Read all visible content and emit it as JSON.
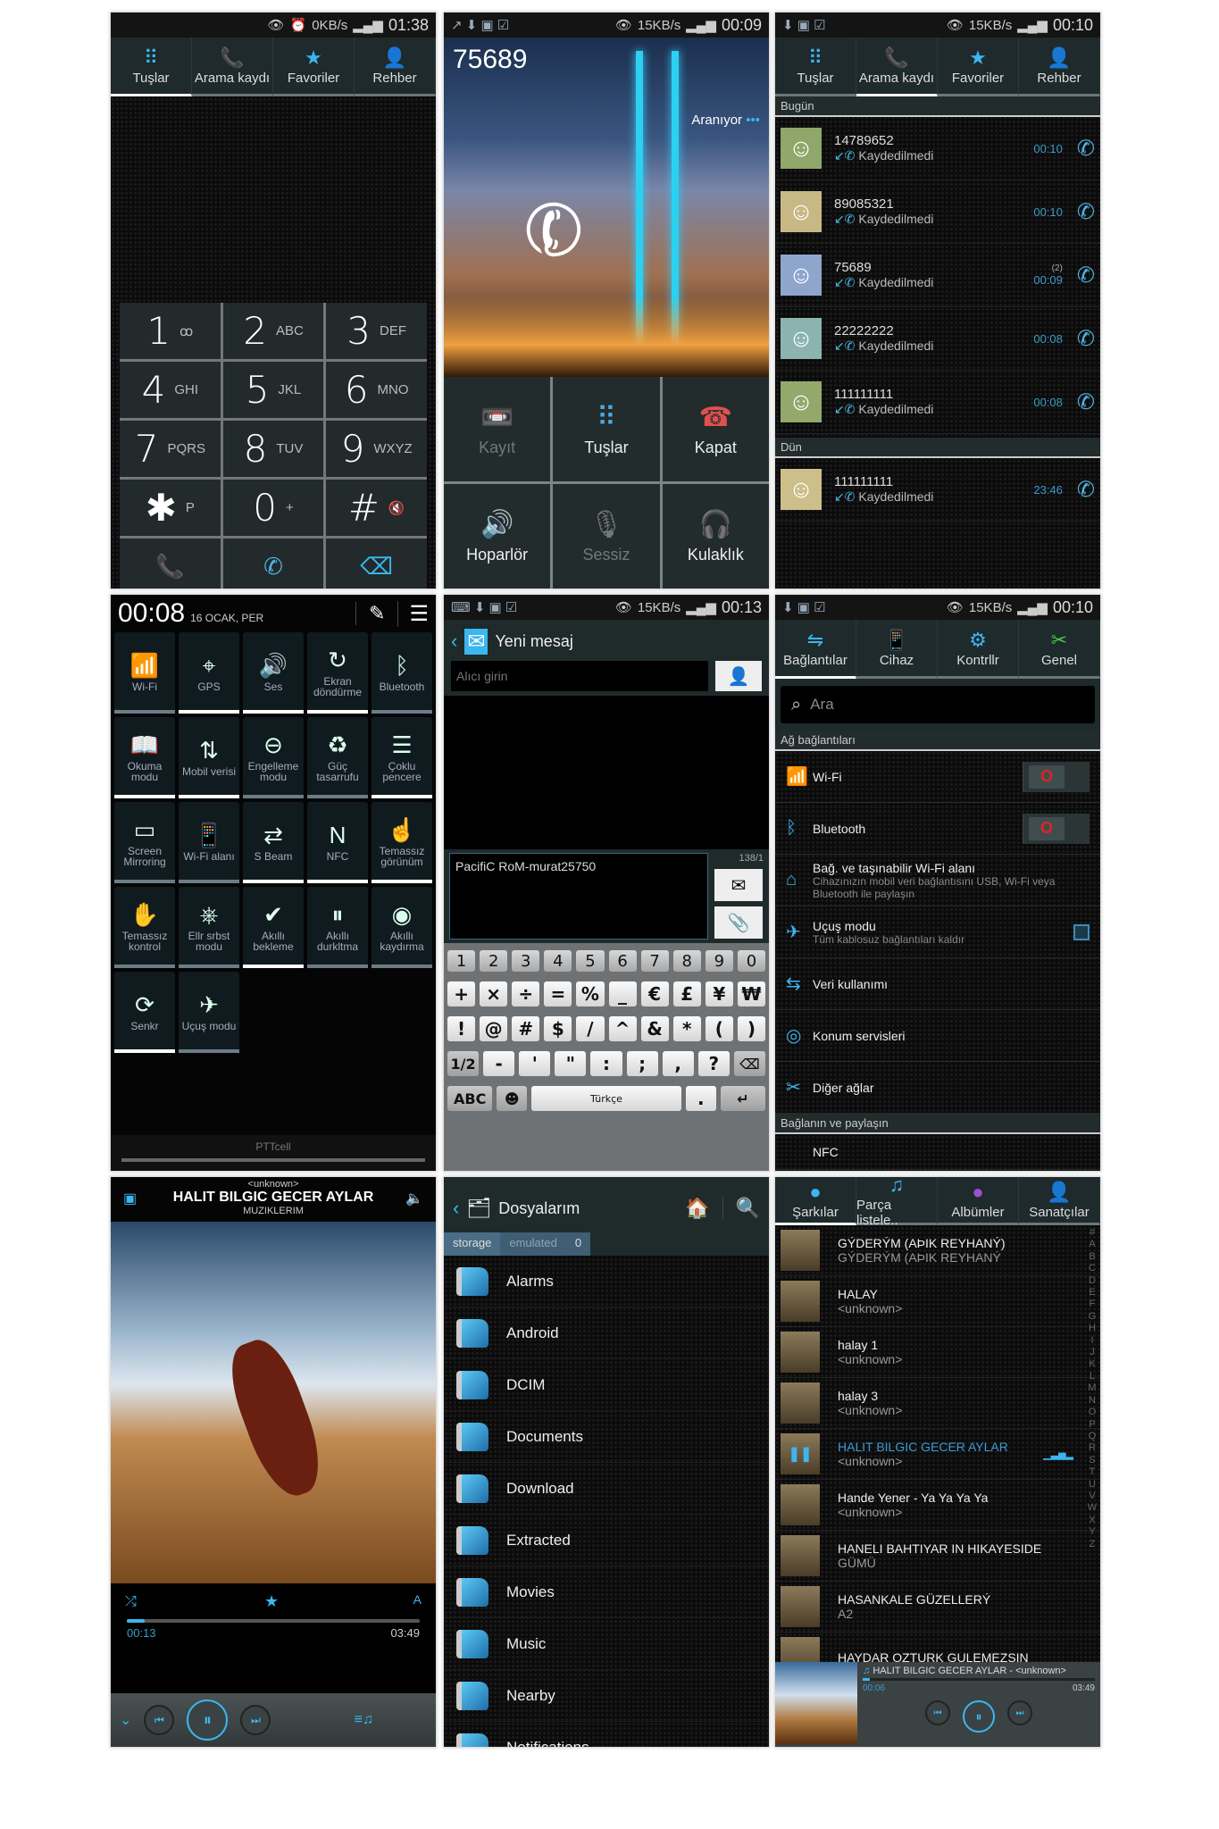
{
  "dialer": {
    "status": {
      "speed": "0KB/s",
      "time": "01:38"
    },
    "tabs": [
      {
        "label": "Tuşlar",
        "icon": "keypad-icon"
      },
      {
        "label": "Arama kaydı",
        "icon": "call-log-icon"
      },
      {
        "label": "Favoriler",
        "icon": "star-icon"
      },
      {
        "label": "Rehber",
        "icon": "contacts-icon"
      }
    ],
    "keys": [
      {
        "d": "1",
        "l": "ꝏ"
      },
      {
        "d": "2",
        "l": "ABC"
      },
      {
        "d": "3",
        "l": "DEF"
      },
      {
        "d": "4",
        "l": "GHI"
      },
      {
        "d": "5",
        "l": "JKL"
      },
      {
        "d": "6",
        "l": "MNO"
      },
      {
        "d": "7",
        "l": "PQRS"
      },
      {
        "d": "8",
        "l": "TUV"
      },
      {
        "d": "9",
        "l": "WXYZ"
      },
      {
        "d": "✱",
        "l": "P"
      },
      {
        "d": "0",
        "l": "+"
      },
      {
        "d": "#",
        "l": "🔇"
      }
    ]
  },
  "incall": {
    "status": {
      "speed": "15KB/s",
      "time": "00:09"
    },
    "number": "75689",
    "state": "Aranıyor",
    "buttons": [
      {
        "label": "Kayıt",
        "icon": "📼"
      },
      {
        "label": "Tuşlar",
        "icon": "⠿"
      },
      {
        "label": "Kapat",
        "icon": "☎"
      },
      {
        "label": "Hoparlör",
        "icon": "🔊"
      },
      {
        "label": "Sessiz",
        "icon": "🎙"
      },
      {
        "label": "Kulaklık",
        "icon": "🎧"
      }
    ]
  },
  "calllog": {
    "status": {
      "speed": "15KB/s",
      "time": "00:10"
    },
    "tabs": [
      {
        "label": "Tuşlar"
      },
      {
        "label": "Arama kaydı"
      },
      {
        "label": "Favoriler"
      },
      {
        "label": "Rehber"
      }
    ],
    "today": "Bugün",
    "yesterday": "Dün",
    "entries": [
      {
        "number": "14789652",
        "status": "Kaydedilmedi",
        "time": "00:10",
        "count": "",
        "color": "#8fa76a"
      },
      {
        "number": "89085321",
        "status": "Kaydedilmedi",
        "time": "00:10",
        "count": "",
        "color": "#c8b884"
      },
      {
        "number": "75689",
        "status": "Kaydedilmedi",
        "time": "00:09",
        "count": "(2)",
        "color": "#8ea6cc"
      },
      {
        "number": "22222222",
        "status": "Kaydedilmedi",
        "time": "00:08",
        "count": "",
        "color": "#8bb4b0"
      },
      {
        "number": "111111111",
        "status": "Kaydedilmedi",
        "time": "00:08",
        "count": "",
        "color": "#93a96c"
      }
    ],
    "yesterday_entries": [
      {
        "number": "111111111",
        "status": "Kaydedilmedi",
        "time": "23:46",
        "count": "",
        "color": "#cdbf8a"
      }
    ]
  },
  "quick": {
    "time": "00:08",
    "date": "16 OCAK, PER",
    "carrier": "PTTcell",
    "tiles": [
      {
        "label": "Wi-Fi",
        "icon": "📶",
        "on": false
      },
      {
        "label": "GPS",
        "icon": "⌖",
        "on": true
      },
      {
        "label": "Ses",
        "icon": "🔊",
        "on": true
      },
      {
        "label": "Ekran döndürme",
        "icon": "↻",
        "on": true
      },
      {
        "label": "Bluetooth",
        "icon": "ᛒ",
        "on": false
      },
      {
        "label": "Okuma modu",
        "icon": "📖",
        "on": true
      },
      {
        "label": "Mobil verisi",
        "icon": "⇅",
        "on": true
      },
      {
        "label": "Engelleme modu",
        "icon": "⊖",
        "on": false
      },
      {
        "label": "Güç tasarrufu",
        "icon": "♻",
        "on": false
      },
      {
        "label": "Çoklu pencere",
        "icon": "☰",
        "on": true
      },
      {
        "label": "Screen Mirroring",
        "icon": "▭",
        "on": false
      },
      {
        "label": "Wi-Fi alanı",
        "icon": "📱",
        "on": false
      },
      {
        "label": "S Beam",
        "icon": "⇄",
        "on": true
      },
      {
        "label": "NFC",
        "icon": "N",
        "on": true
      },
      {
        "label": "Temassız görünüm",
        "icon": "☝",
        "on": true
      },
      {
        "label": "Temassız kontrol",
        "icon": "✋",
        "on": false
      },
      {
        "label": "Ellr srbst modu",
        "icon": "⎈",
        "on": false
      },
      {
        "label": "Akıllı bekleme",
        "icon": "✔",
        "on": true
      },
      {
        "label": "Akıllı durkltma",
        "icon": "⏸",
        "on": false
      },
      {
        "label": "Akıllı kaydırma",
        "icon": "◉",
        "on": false
      },
      {
        "label": "Senkr",
        "icon": "⟳",
        "on": true
      },
      {
        "label": "Uçuş modu",
        "icon": "✈",
        "on": false
      }
    ]
  },
  "message": {
    "status": {
      "speed": "15KB/s",
      "time": "00:13"
    },
    "title": "Yeni mesaj",
    "recipient_placeholder": "Alıcı girin",
    "body": "PacifiC RoM-murat25750",
    "counter": "138/1",
    "keys_row1": [
      "1",
      "2",
      "3",
      "4",
      "5",
      "6",
      "7",
      "8",
      "9",
      "0"
    ],
    "keys_row2": [
      "+",
      "×",
      "÷",
      "=",
      "%",
      "_",
      "€",
      "£",
      "¥",
      "₩"
    ],
    "keys_row3": [
      "!",
      "@",
      "#",
      "$",
      "/",
      "^",
      "&",
      "*",
      "(",
      ")"
    ],
    "keys_row4": [
      "1/2",
      "-",
      "'",
      "\"",
      ":",
      ";",
      ",",
      "?",
      "⌫"
    ],
    "abc": "ABC",
    "space": "Türkçe",
    "period": ".",
    "enter": "↵"
  },
  "settings": {
    "status": {
      "speed": "15KB/s",
      "time": "00:10"
    },
    "tabs": [
      {
        "label": "Bağlantılar"
      },
      {
        "label": "Cihaz"
      },
      {
        "label": "Kontrllr"
      },
      {
        "label": "Genel"
      }
    ],
    "search_placeholder": "Ara",
    "section1": "Ağ bağlantıları",
    "items": [
      {
        "title": "Wi-Fi",
        "sub": "",
        "icon": "📶",
        "control": "toggle"
      },
      {
        "title": "Bluetooth",
        "sub": "",
        "icon": "ᛒ",
        "control": "toggle"
      },
      {
        "title": "Bağ. ve taşınabilir Wi-Fi alanı",
        "sub": "Cihazınızın mobil veri bağlantısını USB, Wi-Fi veya Bluetooth ile paylaşın",
        "icon": "⌂",
        "control": ""
      },
      {
        "title": "Uçuş modu",
        "sub": "Tüm kablosuz bağlantıları kaldır",
        "icon": "✈",
        "control": "checkbox"
      },
      {
        "title": "Veri kullanımı",
        "sub": "",
        "icon": "⇆",
        "control": ""
      },
      {
        "title": "Konum servisleri",
        "sub": "",
        "icon": "◎",
        "control": ""
      },
      {
        "title": "Diğer ağlar",
        "sub": "",
        "icon": "✂",
        "control": ""
      }
    ],
    "section2": "Bağlanın ve paylaşın",
    "nfc": "NFC"
  },
  "player": {
    "artist": "<unknown>",
    "title": "HALIT BILGIC GECER AYLAR",
    "album": "MUZIKLERIM",
    "elapsed": "00:13",
    "duration": "03:49",
    "progress": 0.06
  },
  "files": {
    "title": "Dosyalarım",
    "breadcrumb": [
      "storage",
      "emulated",
      "0"
    ],
    "folders": [
      "Alarms",
      "Android",
      "DCIM",
      "Documents",
      "Download",
      "Extracted",
      "Movies",
      "Music",
      "Nearby",
      "Notifications"
    ]
  },
  "musiclist": {
    "tabs": [
      {
        "label": "Şarkılar"
      },
      {
        "label": "Parça listele.."
      },
      {
        "label": "Albümler"
      },
      {
        "label": "Sanatçılar"
      }
    ],
    "songs": [
      {
        "title": "GÝDERÝM (AÞIK REYHANÝ)",
        "artist": "GÝDERÝM (AÞIK REYHANÝ",
        "playing": false
      },
      {
        "title": "HALAY",
        "artist": "<unknown>",
        "playing": false
      },
      {
        "title": "halay 1",
        "artist": "<unknown>",
        "playing": false
      },
      {
        "title": "halay 3",
        "artist": "<unknown>",
        "playing": false
      },
      {
        "title": "HALIT BILGIC GECER AYLAR",
        "artist": "<unknown>",
        "playing": true
      },
      {
        "title": "Hande Yener - Ya Ya Ya Ya",
        "artist": "<unknown>",
        "playing": false
      },
      {
        "title": "HANELI BAHTIYAR IN HIKAYESIDE",
        "artist": "GÜMÜ",
        "playing": false
      },
      {
        "title": "HASANKALE GÜZELLERÝ",
        "artist": "A2",
        "playing": false
      },
      {
        "title": "HAYDAR OZTURK GULEMEZSIN",
        "artist": "",
        "playing": false
      }
    ],
    "index": [
      "#",
      "A",
      "B",
      "C",
      "D",
      "E",
      "F",
      "G",
      "H",
      "I",
      "J",
      "K",
      "L",
      "M",
      "N",
      "O",
      "P",
      "Q",
      "R",
      "S",
      "T",
      "U",
      "V",
      "W",
      "X",
      "Y",
      "Z"
    ],
    "mini": {
      "now_playing": "HALIT BILGIC GECER AYLAR - <unknown>",
      "elapsed": "00:06",
      "duration": "03:49",
      "progress": 0.03
    }
  }
}
